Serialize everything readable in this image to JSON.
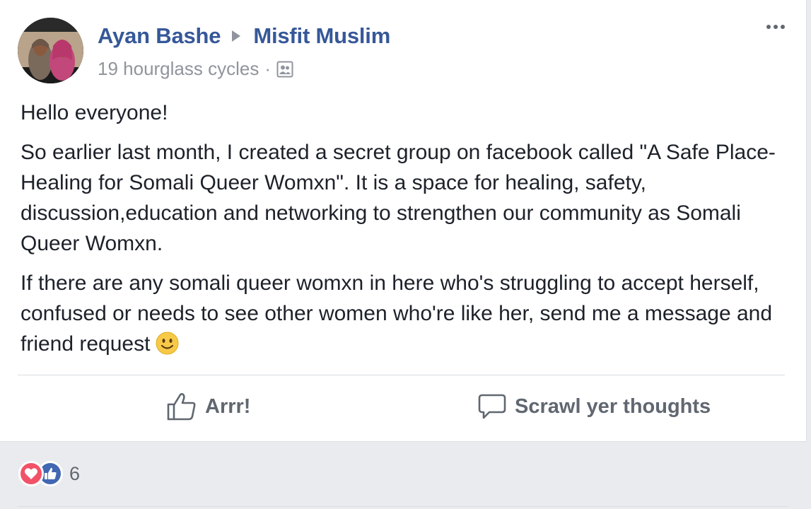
{
  "post": {
    "author": "Ayan Bashe",
    "group": "Misfit Muslim",
    "timestamp": "19 hourglass cycles",
    "separator": "·",
    "audience_icon": "group-audience-icon",
    "paragraphs": [
      "Hello everyone!",
      "So earlier last month, I created a secret group on facebook called \"A Safe Place- Healing for Somali Queer Womxn\". It is a space for healing, safety, discussion,education and networking to strengthen our community as Somali Queer Womxn.",
      "If there are any somali queer womxn in here who's struggling to accept herself, confused or needs to see other women who're like her, send me a message and friend request"
    ],
    "emoji": "smiley-emoji"
  },
  "actions": {
    "like_label": "Arrr!",
    "comment_label": "Scrawl yer thoughts"
  },
  "reactions": {
    "types": [
      "love",
      "like"
    ],
    "count": "6"
  },
  "colors": {
    "link_blue": "#365899",
    "meta_gray": "#90949c",
    "love_red": "#f25268",
    "like_blue": "#4267b2"
  }
}
